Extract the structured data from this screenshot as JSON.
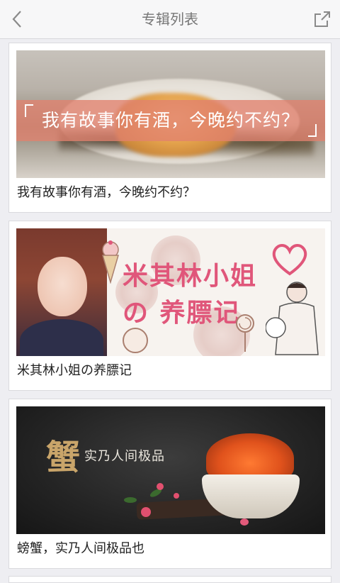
{
  "header": {
    "title": "专辑列表"
  },
  "cards": [
    {
      "banner_text": "我有故事你有酒，今晚约不约？",
      "caption": "我有故事你有酒，今晚约不约？"
    },
    {
      "banner_line1": "米其林小姐",
      "banner_line2": "の 养膘记",
      "caption": "米其林小姐の养膘记"
    },
    {
      "banner_big": "蟹",
      "banner_small": "实乃人间极品",
      "caption": "螃蟹，实乃人间极品也"
    }
  ],
  "colors": {
    "accent_pink": "#e0567a",
    "gold": "#c9a56a"
  }
}
